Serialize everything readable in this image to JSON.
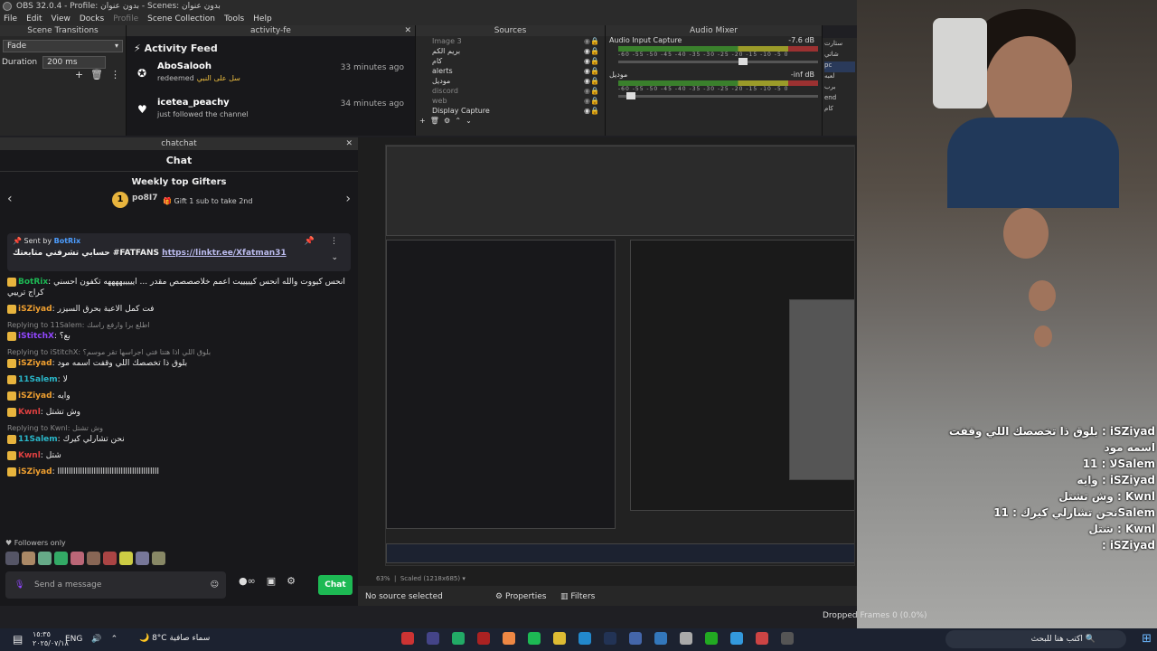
{
  "window": {
    "title": "OBS 32.0.4 - Profile: بدون عنوان - Scenes: بدون عنوان"
  },
  "menu": [
    "File",
    "Edit",
    "View",
    "Docks",
    "Profile",
    "Scene Collection",
    "Tools",
    "Help"
  ],
  "scene_transitions": {
    "title": "Scene Transitions",
    "transition": "Fade",
    "duration_label": "Duration",
    "duration_value": "200 ms"
  },
  "activity_feed": {
    "dock_title": "activity-fe",
    "heading": "Activity Feed",
    "items": [
      {
        "name": "AboSalooh",
        "action": "redeemed",
        "reward": "سل على النبي",
        "time": "33 minutes ago",
        "icon": "reward-icon"
      },
      {
        "name": "icetea_peachy",
        "action": "just followed the channel",
        "time": "34 minutes ago",
        "icon": "heart-icon"
      }
    ]
  },
  "sources": {
    "title": "Sources",
    "items": [
      "Image 3",
      "بريم الكم",
      "كام",
      "alerts",
      "موديل",
      "discord",
      "web",
      "Display Capture"
    ]
  },
  "audio_mixer": {
    "title": "Audio Mixer",
    "tracks": [
      {
        "name": "Audio Input Capture",
        "level": "-7.6 dB"
      },
      {
        "name": "موديل",
        "level": "-inf dB"
      }
    ],
    "scale": "-60 -55 -50 -45 -40 -35 -30 -25 -20 -15 -10 -5 0"
  },
  "scenes_side": [
    "ستارت",
    "شاتي",
    "pc",
    "لعبه",
    "برب",
    "end",
    "كام"
  ],
  "chat": {
    "dock_title": "chatchat",
    "title": "Chat",
    "gifters_heading": "Weekly top Gifters",
    "top_gifter": "po8I7",
    "top_gifter_count": "1",
    "gift_hint": "Gift 1 sub to take 2nd",
    "pinned_sent_by": "Sent by",
    "pinned_user": "BotRix",
    "pinned_text": "حسابي تشرفني متابعتك #FATFANS",
    "pinned_link": "https://linktr.ee/Xfatman31",
    "messages": [
      {
        "user": "BotRix",
        "text": "انحس كيووت والله انحس كيييييت اعمم خلاصصصص مقدر ... ايييييههههه تكفون احسني كراج ترييي",
        "color": "#1db954"
      },
      {
        "user": "iSZiyad",
        "text": "فت كمل الاعبة بحرق السيزر",
        "color": "#f0a030"
      },
      {
        "reply": "Replying to 11Salem: اطلع برا وارفع راسك",
        "user": "iStitchX",
        "text": "بع؟",
        "color": "#9146ff"
      },
      {
        "reply": "Replying to iStitchX: بلوق اللي اذا هتتا فتي اجراسها تقر موسم؟",
        "user": "iSZiyad",
        "text": "بلوق ذا تخصصك اللي وقفت اسمه مود",
        "color": "#f0a030"
      },
      {
        "user": "11Salem",
        "text": "لا",
        "color": "#2ab7c9"
      },
      {
        "user": "iSZiyad",
        "text": "وايه",
        "color": "#f0a030"
      },
      {
        "user": "Kwnl",
        "text": "وش تشتل",
        "color": "#e04040"
      },
      {
        "reply": "Replying to Kwnl: وش تشتل",
        "user": "11Salem",
        "text": "نحن تشارلي كيرك",
        "color": "#2ab7c9"
      },
      {
        "user": "Kwnl",
        "text": "شتل",
        "color": "#e04040"
      },
      {
        "user": "iSZiyad",
        "text": "ااااااااااااااااااااااااااااااااااااااااااااا",
        "color": "#f0a030"
      }
    ],
    "followers_only": "Followers only",
    "input_placeholder": "Send a message",
    "chat_button": "Chat"
  },
  "preview": {
    "zoom": "63%",
    "scaled": "Scaled (1218x685)"
  },
  "status": {
    "no_source": "No source selected",
    "properties": "Properties",
    "filters": "Filters"
  },
  "overlay_chat": [
    "بلوق ذا تخصصك اللي وقفت : iSZiyad",
    "اسمه مود",
    "لا : 11Salem",
    "وايه : iSZiyad",
    "وش تشتل : Kwnl",
    "نحن تشارلي كيرك : 11Salem",
    "شتل : Kwnl",
    ": iSZiyad"
  ],
  "dropped": "Dropped Frames 0 (0.0%)",
  "taskbar": {
    "time": "١٥:٣٥",
    "date": "٢٠٢٥/٠٧/١٨",
    "lang": "ENG",
    "temp": "8°C",
    "weather": "سماء صافية",
    "search": "اكتب هنا للبحث"
  }
}
